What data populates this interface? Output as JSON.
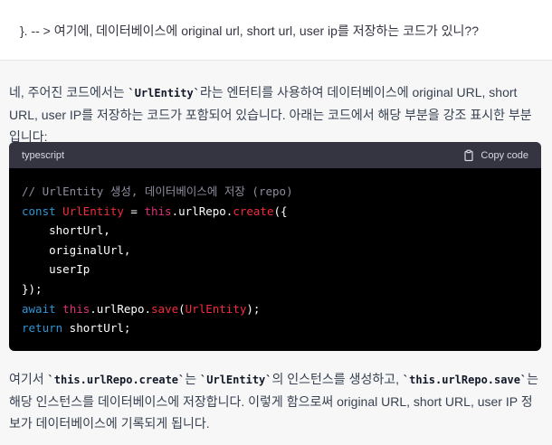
{
  "user_message": "}.  -- > 여기에, 데이터베이스에 original url, short url, user ip를 저장하는 코드가 있니??",
  "assistant": {
    "para1": {
      "before": "네, 주어진 코드에서는 ",
      "code1": "`UrlEntity`",
      "after": "라는 엔터티를 사용하여 데이터베이스에 original URL, short URL, user IP를 저장하는 코드가 포함되어 있습니다. 아래는 코드에서 해당 부분을 강조 표시한 부분입니다:"
    },
    "code_block": {
      "language": "typescript",
      "copy_label": "Copy code",
      "lines": {
        "l1_comment": "// UrlEntity 생성, 데이터베이스에 저장 (repo)",
        "l2_const": "const",
        "l2_var": "UrlEntity",
        "l2_eq": " = ",
        "l2_this": "this",
        "l2_repo": ".urlRepo.",
        "l2_fn": "create",
        "l2_end": "({",
        "l3": "    shortUrl,",
        "l4": "    originalUrl,",
        "l5": "    userIp",
        "l6": "});",
        "l7_await": "await",
        "l7_this": "this",
        "l7_repo": ".urlRepo.",
        "l7_fn": "save",
        "l7_open": "(",
        "l7_var": "UrlEntity",
        "l7_close": ");",
        "l8_return": "return",
        "l8_rest": " shortUrl;"
      }
    },
    "para2": {
      "t1": "여기서 ",
      "code1": "`this.urlRepo.create`",
      "t2": "는 ",
      "code2": "`UrlEntity`",
      "t3": "의 인스턴스를 생성하고, ",
      "code3": "`this.urlRepo.save`",
      "t4": "는 해당 인스턴스를 데이터베이스에 저장합니다. 이렇게 함으로써 original URL, short URL, user IP 정보가 데이터베이스에 기록되게 됩니다."
    }
  }
}
